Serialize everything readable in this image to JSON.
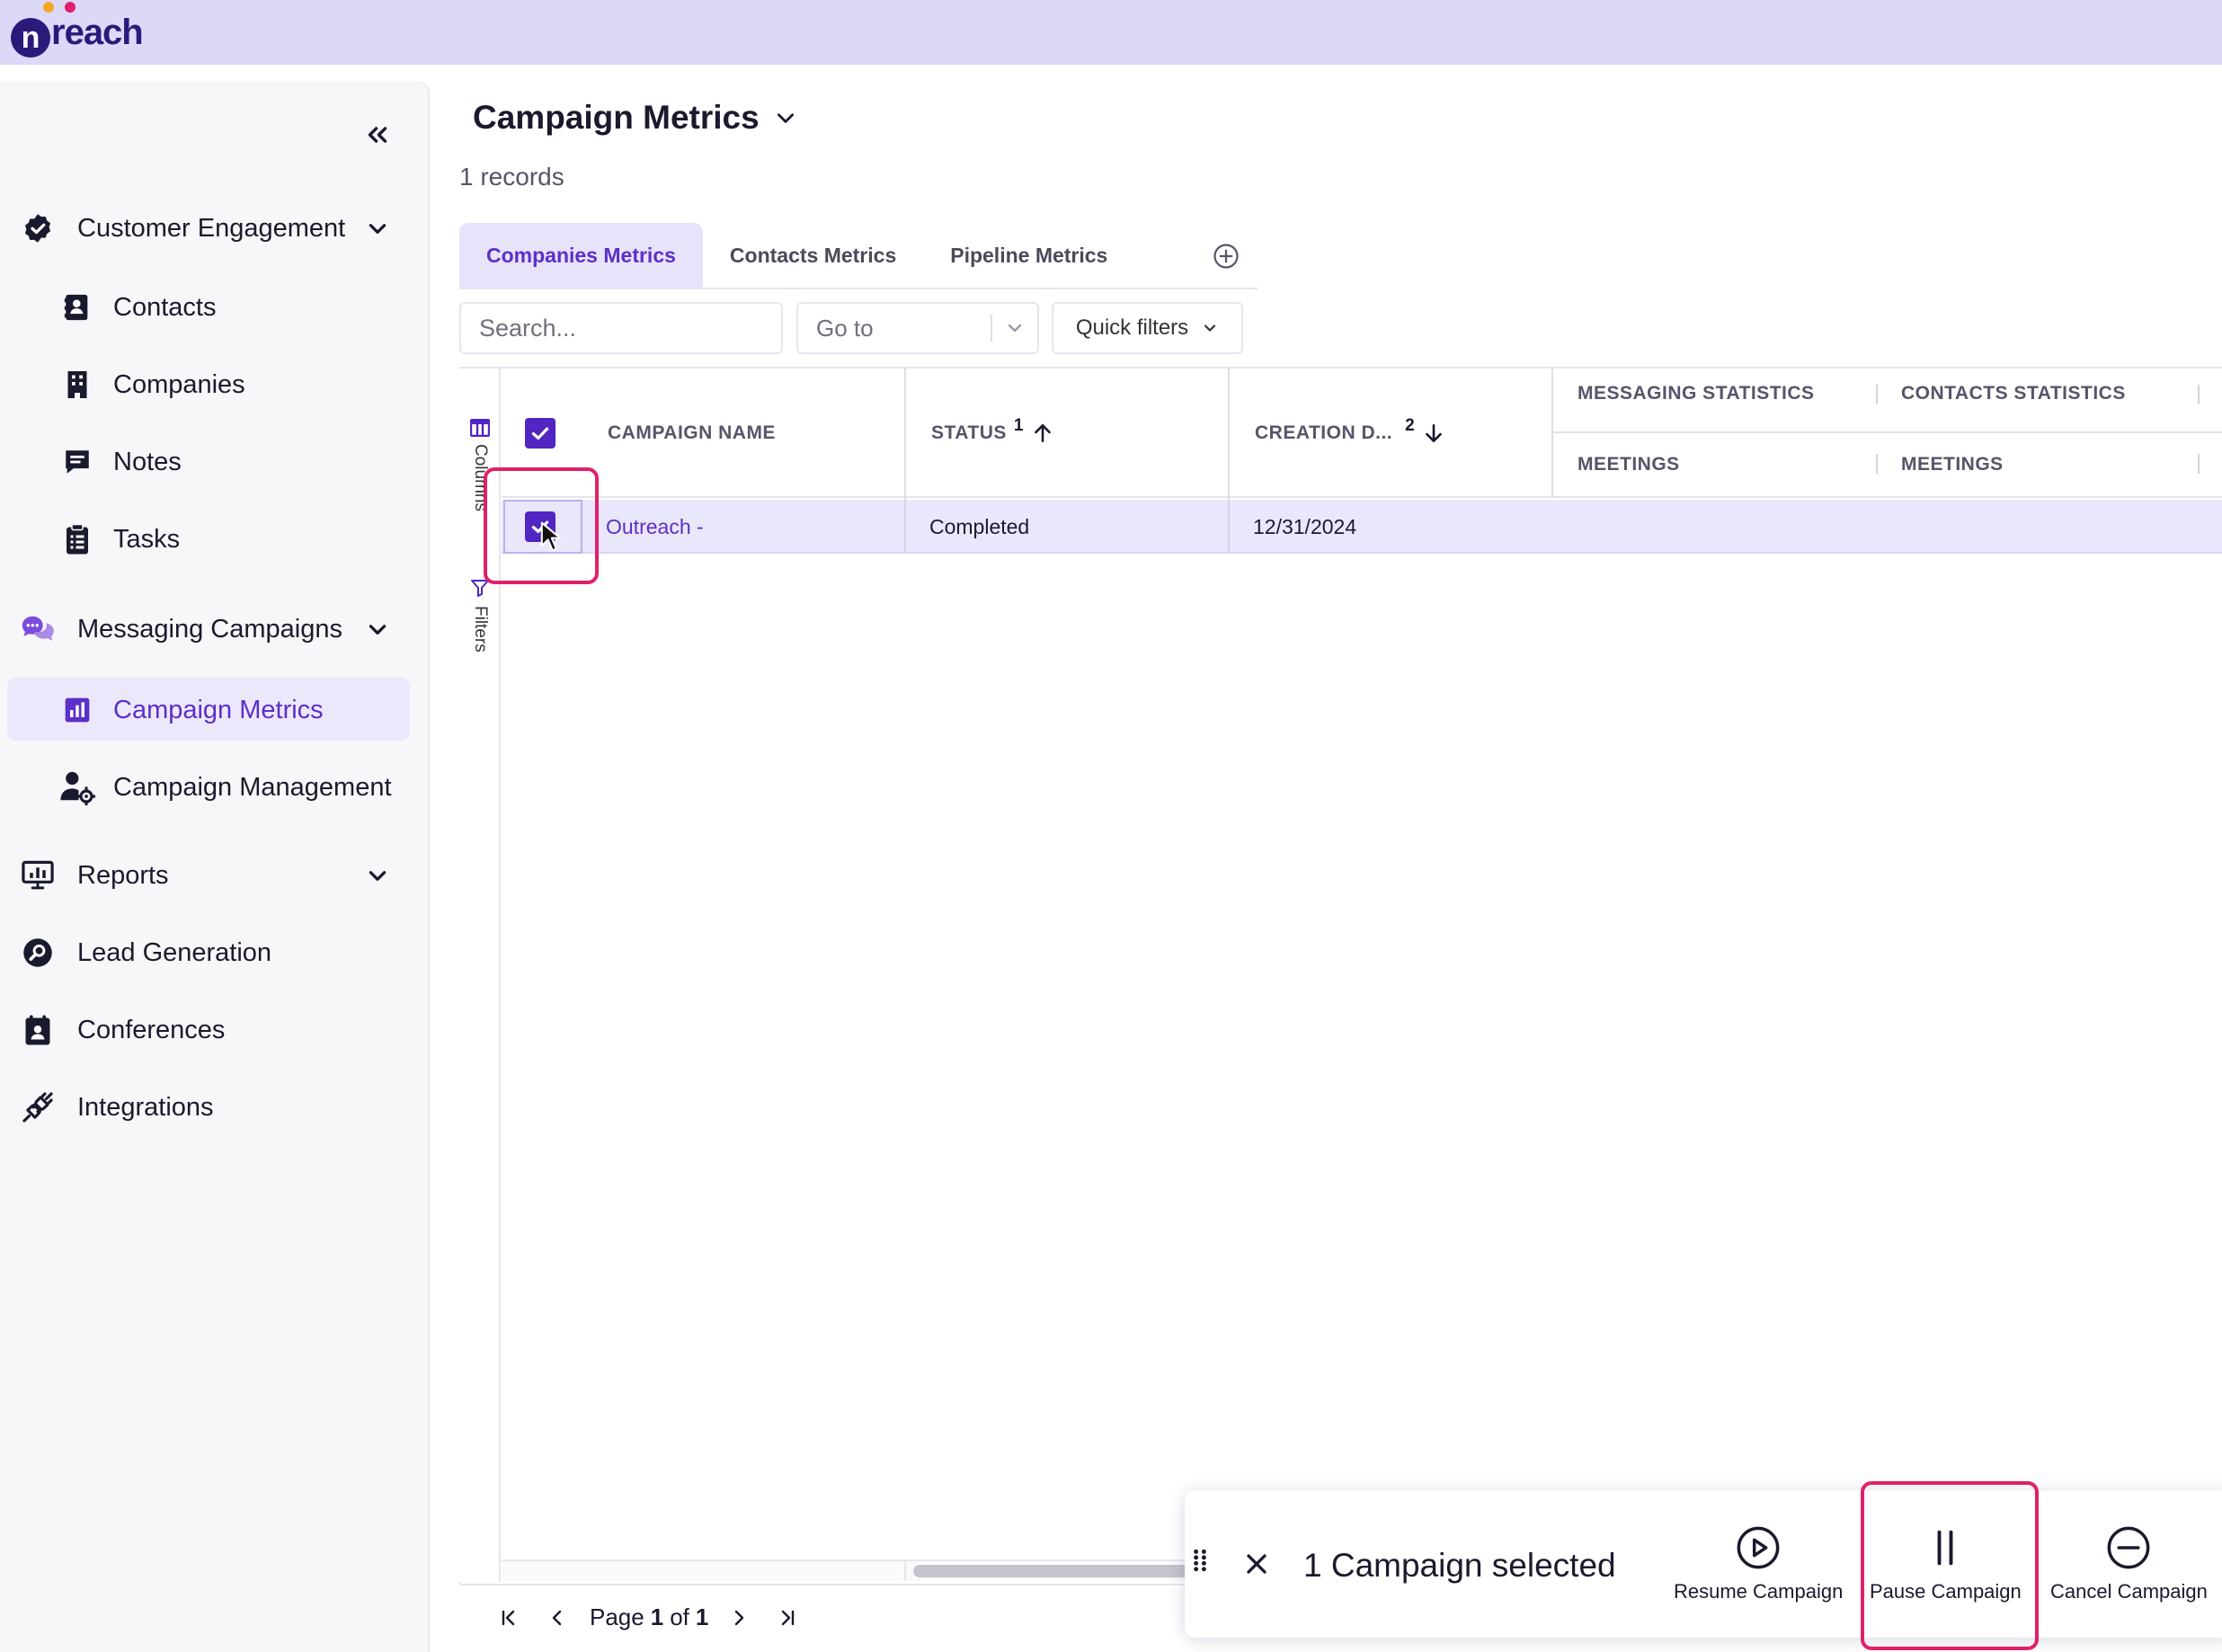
{
  "app": {
    "logo_n": "n",
    "logo_rest": "reach"
  },
  "sidebar": {
    "sections": [
      {
        "label": "Customer Engagement",
        "icon": "check-badge-icon"
      },
      {
        "label": "Messaging Campaigns",
        "icon": "chat-bubbles-icon"
      },
      {
        "label": "Reports",
        "icon": "monitor-chart-icon"
      },
      {
        "label": "Lead Generation",
        "icon": "search-circle-icon"
      },
      {
        "label": "Conferences",
        "icon": "calendar-user-icon"
      },
      {
        "label": "Integrations",
        "icon": "plug-icon"
      }
    ],
    "engagement_items": [
      {
        "label": "Contacts",
        "icon": "contact-card-icon"
      },
      {
        "label": "Companies",
        "icon": "building-icon"
      },
      {
        "label": "Notes",
        "icon": "note-icon"
      },
      {
        "label": "Tasks",
        "icon": "clipboard-icon"
      }
    ],
    "messaging_items": [
      {
        "label": "Campaign Metrics",
        "icon": "bar-chart-icon",
        "active": true
      },
      {
        "label": "Campaign Management",
        "icon": "user-gear-icon"
      }
    ]
  },
  "page": {
    "title": "Campaign Metrics",
    "records": "1 records"
  },
  "tabs": [
    {
      "label": "Companies Metrics",
      "active": true
    },
    {
      "label": "Contacts Metrics"
    },
    {
      "label": "Pipeline Metrics"
    }
  ],
  "toolbar": {
    "search_placeholder": "Search...",
    "goto_label": "Go to",
    "quick_filters_label": "Quick filters"
  },
  "rail": {
    "columns_label": "Columns",
    "filters_label": "Filters"
  },
  "grid": {
    "columns": {
      "campaign_name": "CAMPAIGN NAME",
      "status": "STATUS",
      "status_sort_index": "1",
      "creation_date": "CREATION D...",
      "creation_sort_index": "2"
    },
    "groups": {
      "messaging": "MESSAGING STATISTICS",
      "contacts": "CONTACTS STATISTICS",
      "messaging_sub": "MEETINGS",
      "contacts_sub": "MEETINGS"
    },
    "rows": [
      {
        "campaign_name": "Outreach -",
        "status": "Completed",
        "creation_date": "12/31/2024",
        "selected": true
      }
    ]
  },
  "pager": {
    "page_word": "Page",
    "current": "1",
    "of_word": "of",
    "total": "1"
  },
  "action_bar": {
    "selected_text": "1 Campaign selected",
    "resume": "Resume Campaign",
    "pause": "Pause Campaign",
    "cancel": "Cancel Campaign"
  },
  "colors": {
    "accent": "#5126c3",
    "topbar": "#dcd8f8",
    "highlight": "#e0206b",
    "selected_row": "#e9e7fb"
  }
}
